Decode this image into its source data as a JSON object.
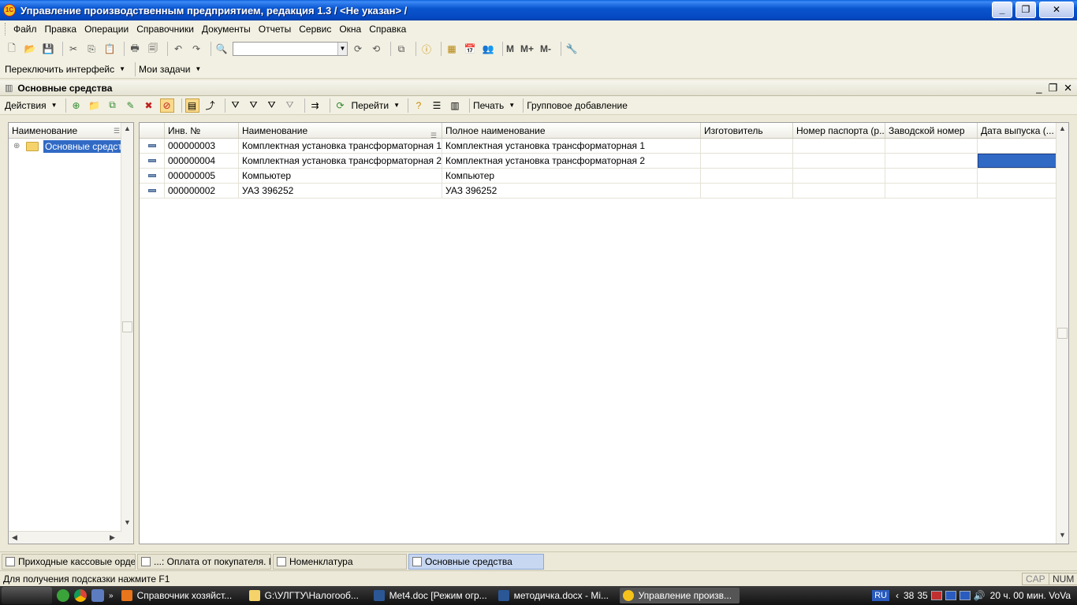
{
  "window": {
    "title": "Управление производственным предприятием, редакция 1.3 / <Не указан> /",
    "app_icon_text": "1С"
  },
  "menu": [
    "Файл",
    "Правка",
    "Операции",
    "Справочники",
    "Документы",
    "Отчеты",
    "Сервис",
    "Окна",
    "Справка"
  ],
  "toolbar2": {
    "switch_interface": "Переключить интерфейс",
    "my_tasks": "Мои задачи"
  },
  "toolbar_memory": [
    "M",
    "M+",
    "M-"
  ],
  "inner_window": {
    "title": "Основные средства"
  },
  "actionbar": {
    "actions": "Действия",
    "goto": "Перейти",
    "print": "Печать",
    "group_add": "Групповое добавление"
  },
  "tree": {
    "header": "Наименование",
    "items": [
      {
        "label": "Основные средства",
        "selected": true
      }
    ]
  },
  "grid": {
    "columns": [
      "Инв. №",
      "Наименование",
      "Полное наименование",
      "Изготовитель",
      "Номер паспорта (р...",
      "Заводской номер",
      "Дата выпуска (..."
    ],
    "rows": [
      {
        "inv": "000000003",
        "name": "Комплектная установка трансформаторная 1",
        "full_name": "Комплектная установка трансформаторная 1",
        "maker": "",
        "passport": "",
        "serial": "",
        "date": ""
      },
      {
        "inv": "000000004",
        "name": "Комплектная установка трансформаторная 2",
        "full_name": "Комплектная установка трансформаторная 2",
        "maker": "",
        "passport": "",
        "serial": "",
        "date": ""
      },
      {
        "inv": "000000005",
        "name": "Компьютер",
        "full_name": "Компьютер",
        "maker": "",
        "passport": "",
        "serial": "",
        "date": ""
      },
      {
        "inv": "000000002",
        "name": "УАЗ 396252",
        "full_name": "УАЗ 396252",
        "maker": "",
        "passport": "",
        "serial": "",
        "date": ""
      }
    ]
  },
  "window_tabs": [
    {
      "label": "Приходные кассовые ордера",
      "active": false
    },
    {
      "label": "...: Оплата от покупателя. П...",
      "active": false
    },
    {
      "label": "Номенклатура",
      "active": false
    },
    {
      "label": "Основные средства",
      "active": true
    }
  ],
  "status": {
    "hint": "Для получения подсказки нажмите F1",
    "cap": "CAP",
    "num": "NUM"
  },
  "taskbar": {
    "tasks": [
      {
        "label": "Справочник хозяйст...",
        "color": "#E8741C"
      },
      {
        "label": "G:\\УЛГТУ\\Налогооб...",
        "color": "#F5D36A"
      },
      {
        "label": "Met4.doc [Режим огр...",
        "color": "#2B5797"
      },
      {
        "label": "методичка.docx - Mi...",
        "color": "#2B5797"
      },
      {
        "label": "Управление произв...",
        "color": "#F4C21A"
      }
    ],
    "tray_lang": "RU",
    "tray_num": "38",
    "tray_num2": "35",
    "clock": "20 ч. 00 мин. VoVa"
  }
}
